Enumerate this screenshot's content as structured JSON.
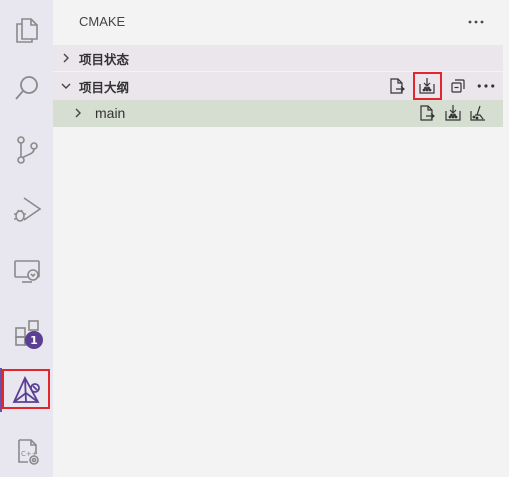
{
  "activity_bar": {
    "icons": [
      "explorer-icon",
      "search-icon",
      "source-control-icon",
      "run-debug-icon",
      "remote-explorer-icon",
      "extensions-icon",
      "cmake-icon",
      "cpp-settings-icon"
    ],
    "extensions_badge": "1",
    "active": "cmake-icon"
  },
  "sidebar": {
    "title": "CMAKE",
    "more_label": "⋯"
  },
  "sections": {
    "project_status": {
      "label": "项目状态",
      "expanded": false
    },
    "project_outline": {
      "label": "项目大纲",
      "expanded": true,
      "more_label": "⋯"
    }
  },
  "tree": {
    "rows": [
      {
        "label": "main",
        "expanded": false
      }
    ]
  },
  "colors": {
    "accent": "#6b4fa0",
    "highlight_box": "#e5242b",
    "selected_row": "#d6ded1",
    "section_bg": "#ebe6ec"
  }
}
